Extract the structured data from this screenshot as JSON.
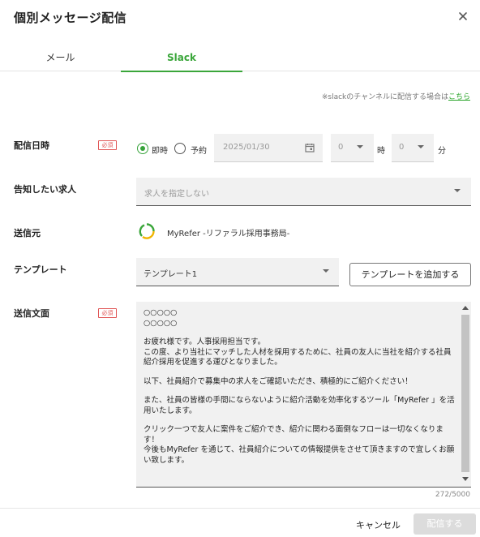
{
  "header": {
    "title": "個別メッセージ配信"
  },
  "tabs": [
    {
      "label": "メール",
      "active": false
    },
    {
      "label": "Slack",
      "active": true
    }
  ],
  "note": {
    "text": "※slackのチャンネルに配信する場合は",
    "link": "こちら"
  },
  "form": {
    "required_badge": "必須",
    "schedule": {
      "label": "配信日時",
      "options": [
        {
          "label": "即時",
          "selected": true
        },
        {
          "label": "予約",
          "selected": false
        }
      ],
      "date_placeholder": "2025/01/30",
      "hour_value": "0",
      "hour_unit": "時",
      "minute_value": "0",
      "minute_unit": "分"
    },
    "job": {
      "label": "告知したい求人",
      "placeholder": "求人を指定しない"
    },
    "sender": {
      "label": "送信元",
      "value": "MyRefer -リファラル採用事務局-"
    },
    "template": {
      "label": "テンプレート",
      "selected": "テンプレート1",
      "add_button": "テンプレートを追加する"
    },
    "body": {
      "label": "送信文面",
      "paragraphs": [
        "○○○○○\n○○○○○",
        "お疲れ様です。人事採用担当です。\nこの度、より当社にマッチした人材を採用するために、社員の友人に当社を紹介する社員紹介採用を促進する運びとなりました。",
        "以下、社員紹介で募集中の求人をご確認いただき、積極的にご紹介ください！",
        "また、社員の皆様の手間にならないように紹介活動を効率化するツール「MyRefer 」を活用いたします。",
        "クリック一つで友人に案件をご紹介でき、紹介に関わる面倒なフローは一切なくなります！\n今後もMyRefer を通じて、社員紹介についての情報提供をさせて頂きますので宜しくお願い致します。"
      ],
      "counter": "272/5000"
    }
  },
  "footer": {
    "cancel": "キャンセル",
    "submit": "配信する"
  },
  "colors": {
    "accent": "#36a33a",
    "required": "#e05555",
    "disabled": "#dcdcdc"
  }
}
